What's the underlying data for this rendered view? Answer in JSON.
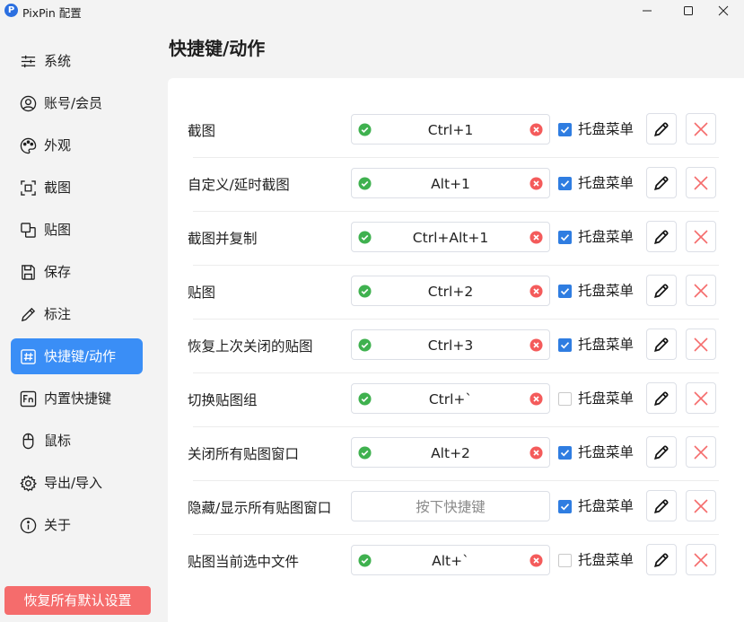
{
  "window": {
    "logo_letter": "P",
    "title": "PixPin 配置"
  },
  "sidebar": {
    "items": [
      {
        "label": "系统",
        "icon": "sliders-icon",
        "active": false
      },
      {
        "label": "账号/会员",
        "icon": "user-icon",
        "active": false
      },
      {
        "label": "外观",
        "icon": "palette-icon",
        "active": false
      },
      {
        "label": "截图",
        "icon": "screenshot-icon",
        "active": false
      },
      {
        "label": "贴图",
        "icon": "pin-image-icon",
        "active": false
      },
      {
        "label": "保存",
        "icon": "save-icon",
        "active": false
      },
      {
        "label": "标注",
        "icon": "pencil-icon",
        "active": false
      },
      {
        "label": "快捷键/动作",
        "icon": "hotkey-icon",
        "active": true
      },
      {
        "label": "内置快捷键",
        "icon": "fn-key-icon",
        "active": false
      },
      {
        "label": "鼠标",
        "icon": "mouse-icon",
        "active": false
      },
      {
        "label": "导出/导入",
        "icon": "gear-icon",
        "active": false
      },
      {
        "label": "关于",
        "icon": "info-icon",
        "active": false
      }
    ],
    "restore_label": "恢复所有默认设置"
  },
  "main": {
    "title": "快捷键/动作",
    "tray_label": "托盘菜单",
    "empty_placeholder": "按下快捷键",
    "rows": [
      {
        "label": "截图",
        "hotkey": "Ctrl+1",
        "tray": true
      },
      {
        "label": "自定义/延时截图",
        "hotkey": "Alt+1",
        "tray": true
      },
      {
        "label": "截图并复制",
        "hotkey": "Ctrl+Alt+1",
        "tray": true
      },
      {
        "label": "贴图",
        "hotkey": "Ctrl+2",
        "tray": true
      },
      {
        "label": "恢复上次关闭的贴图",
        "hotkey": "Ctrl+3",
        "tray": true
      },
      {
        "label": "切换贴图组",
        "hotkey": "Ctrl+`",
        "tray": false
      },
      {
        "label": "关闭所有贴图窗口",
        "hotkey": "Alt+2",
        "tray": true
      },
      {
        "label": "隐藏/显示所有贴图窗口",
        "hotkey": "",
        "tray": true
      },
      {
        "label": "贴图当前选中文件",
        "hotkey": "Alt+`",
        "tray": false
      }
    ]
  },
  "colors": {
    "accent": "#3a8ef6",
    "danger": "#f56c6c",
    "ok": "#3fb14f",
    "check": "#2f7de1"
  }
}
